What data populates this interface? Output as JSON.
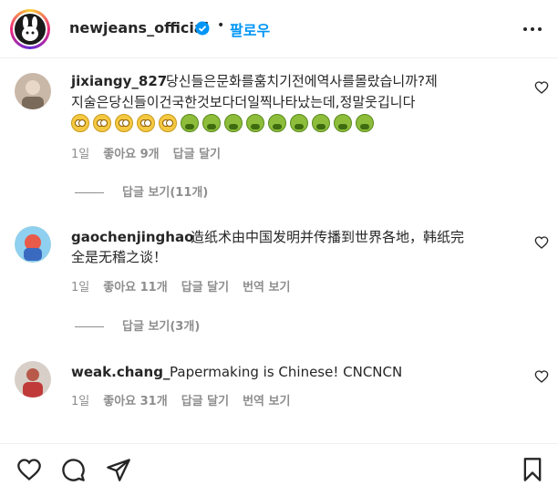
{
  "header": {
    "username": "newjeans_official",
    "dot": "•",
    "follow_label": "팔로우"
  },
  "comments": [
    {
      "user": "jixiangy_827",
      "text_line1": "당신들은문화를훔치기전에역사를몰랐습니까?제",
      "text_line2": "지술은당신들이건국한것보다더일찍나타났는데,정말웃깁니다",
      "emojis": [
        "face-with-rolling-eyes",
        "face-with-rolling-eyes",
        "face-with-rolling-eyes",
        "face-with-rolling-eyes",
        "face-with-rolling-eyes",
        "nauseated-face",
        "nauseated-face",
        "nauseated-face",
        "nauseated-face",
        "nauseated-face",
        "nauseated-face",
        "nauseated-face",
        "nauseated-face",
        "nauseated-face"
      ],
      "time": "1일",
      "likes": "좋아요 9개",
      "reply": "답글 달기",
      "replies_label": "답글 보기(11개)"
    },
    {
      "user": "gaochenjinghao",
      "text_line1": "造纸术由中国发明并传播到世界各地，韩纸完",
      "text_line2": "全是无稽之谈！",
      "time": "1일",
      "likes": "좋아요 11개",
      "reply": "답글 달기",
      "translate": "번역 보기",
      "replies_label": "답글 보기(3개)"
    },
    {
      "user": "weak.chang_",
      "text_line1": "Papermaking is Chinese! CNCNCN",
      "time": "1일",
      "likes": "좋아요 31개",
      "reply": "답글 달기",
      "translate": "번역 보기"
    }
  ],
  "colors": {
    "accent": "#0095f6",
    "text": "#262626",
    "muted": "#8e8e8e"
  },
  "icons": [
    "verified-badge-icon",
    "more-options-icon",
    "heart-icon",
    "comment-icon",
    "share-icon",
    "bookmark-icon"
  ]
}
